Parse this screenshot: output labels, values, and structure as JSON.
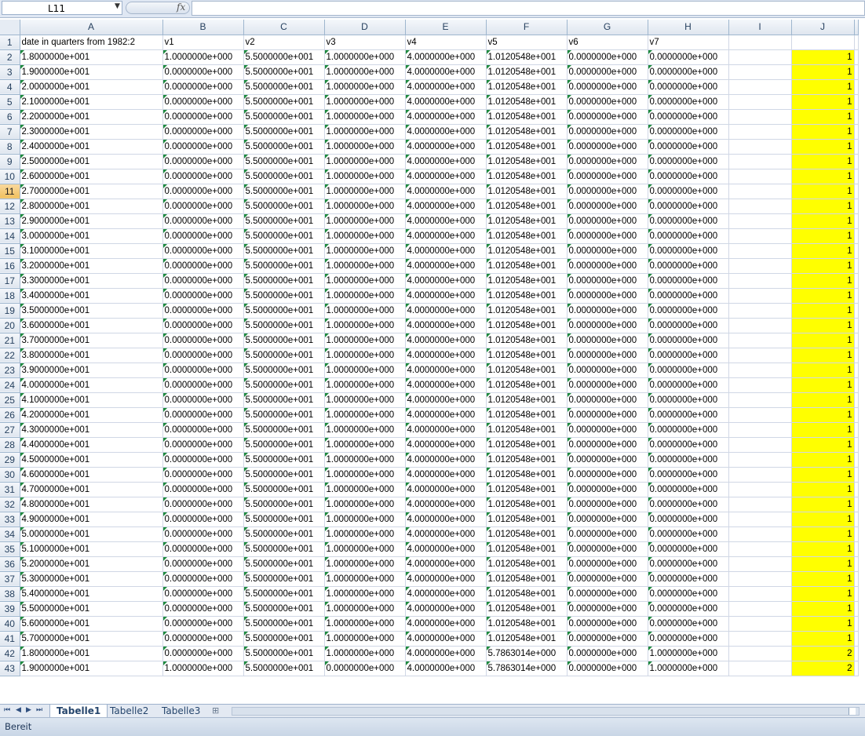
{
  "formula_bar": {
    "name_box": "L11",
    "fx": "fx",
    "formula": ""
  },
  "columns": [
    "A",
    "B",
    "C",
    "D",
    "E",
    "F",
    "G",
    "H",
    "I",
    "J"
  ],
  "selected_row": 11,
  "header_row": {
    "A": "date in quarters from 1982:2",
    "B": "v1",
    "C": "v2",
    "D": "v3",
    "E": "v4",
    "F": "v5",
    "G": "v6",
    "H": "v7"
  },
  "rows": [
    {
      "n": 2,
      "A": "1.8000000e+001",
      "B": "1.0000000e+000",
      "C": "5.5000000e+001",
      "D": "1.0000000e+000",
      "E": "4.0000000e+000",
      "F": "1.0120548e+001",
      "G": "0.0000000e+000",
      "H": "0.0000000e+000",
      "J": "1"
    },
    {
      "n": 3,
      "A": "1.9000000e+001",
      "B": "0.0000000e+000",
      "C": "5.5000000e+001",
      "D": "1.0000000e+000",
      "E": "4.0000000e+000",
      "F": "1.0120548e+001",
      "G": "0.0000000e+000",
      "H": "0.0000000e+000",
      "J": "1"
    },
    {
      "n": 4,
      "A": "2.0000000e+001",
      "B": "0.0000000e+000",
      "C": "5.5000000e+001",
      "D": "1.0000000e+000",
      "E": "4.0000000e+000",
      "F": "1.0120548e+001",
      "G": "0.0000000e+000",
      "H": "0.0000000e+000",
      "J": "1"
    },
    {
      "n": 5,
      "A": "2.1000000e+001",
      "B": "0.0000000e+000",
      "C": "5.5000000e+001",
      "D": "1.0000000e+000",
      "E": "4.0000000e+000",
      "F": "1.0120548e+001",
      "G": "0.0000000e+000",
      "H": "0.0000000e+000",
      "J": "1"
    },
    {
      "n": 6,
      "A": "2.2000000e+001",
      "B": "0.0000000e+000",
      "C": "5.5000000e+001",
      "D": "1.0000000e+000",
      "E": "4.0000000e+000",
      "F": "1.0120548e+001",
      "G": "0.0000000e+000",
      "H": "0.0000000e+000",
      "J": "1"
    },
    {
      "n": 7,
      "A": "2.3000000e+001",
      "B": "0.0000000e+000",
      "C": "5.5000000e+001",
      "D": "1.0000000e+000",
      "E": "4.0000000e+000",
      "F": "1.0120548e+001",
      "G": "0.0000000e+000",
      "H": "0.0000000e+000",
      "J": "1"
    },
    {
      "n": 8,
      "A": "2.4000000e+001",
      "B": "0.0000000e+000",
      "C": "5.5000000e+001",
      "D": "1.0000000e+000",
      "E": "4.0000000e+000",
      "F": "1.0120548e+001",
      "G": "0.0000000e+000",
      "H": "0.0000000e+000",
      "J": "1"
    },
    {
      "n": 9,
      "A": "2.5000000e+001",
      "B": "0.0000000e+000",
      "C": "5.5000000e+001",
      "D": "1.0000000e+000",
      "E": "4.0000000e+000",
      "F": "1.0120548e+001",
      "G": "0.0000000e+000",
      "H": "0.0000000e+000",
      "J": "1"
    },
    {
      "n": 10,
      "A": "2.6000000e+001",
      "B": "0.0000000e+000",
      "C": "5.5000000e+001",
      "D": "1.0000000e+000",
      "E": "4.0000000e+000",
      "F": "1.0120548e+001",
      "G": "0.0000000e+000",
      "H": "0.0000000e+000",
      "J": "1"
    },
    {
      "n": 11,
      "A": "2.7000000e+001",
      "B": "0.0000000e+000",
      "C": "5.5000000e+001",
      "D": "1.0000000e+000",
      "E": "4.0000000e+000",
      "F": "1.0120548e+001",
      "G": "0.0000000e+000",
      "H": "0.0000000e+000",
      "J": "1"
    },
    {
      "n": 12,
      "A": "2.8000000e+001",
      "B": "0.0000000e+000",
      "C": "5.5000000e+001",
      "D": "1.0000000e+000",
      "E": "4.0000000e+000",
      "F": "1.0120548e+001",
      "G": "0.0000000e+000",
      "H": "0.0000000e+000",
      "J": "1"
    },
    {
      "n": 13,
      "A": "2.9000000e+001",
      "B": "0.0000000e+000",
      "C": "5.5000000e+001",
      "D": "1.0000000e+000",
      "E": "4.0000000e+000",
      "F": "1.0120548e+001",
      "G": "0.0000000e+000",
      "H": "0.0000000e+000",
      "J": "1"
    },
    {
      "n": 14,
      "A": "3.0000000e+001",
      "B": "0.0000000e+000",
      "C": "5.5000000e+001",
      "D": "1.0000000e+000",
      "E": "4.0000000e+000",
      "F": "1.0120548e+001",
      "G": "0.0000000e+000",
      "H": "0.0000000e+000",
      "J": "1"
    },
    {
      "n": 15,
      "A": "3.1000000e+001",
      "B": "0.0000000e+000",
      "C": "5.5000000e+001",
      "D": "1.0000000e+000",
      "E": "4.0000000e+000",
      "F": "1.0120548e+001",
      "G": "0.0000000e+000",
      "H": "0.0000000e+000",
      "J": "1"
    },
    {
      "n": 16,
      "A": "3.2000000e+001",
      "B": "0.0000000e+000",
      "C": "5.5000000e+001",
      "D": "1.0000000e+000",
      "E": "4.0000000e+000",
      "F": "1.0120548e+001",
      "G": "0.0000000e+000",
      "H": "0.0000000e+000",
      "J": "1"
    },
    {
      "n": 17,
      "A": "3.3000000e+001",
      "B": "0.0000000e+000",
      "C": "5.5000000e+001",
      "D": "1.0000000e+000",
      "E": "4.0000000e+000",
      "F": "1.0120548e+001",
      "G": "0.0000000e+000",
      "H": "0.0000000e+000",
      "J": "1"
    },
    {
      "n": 18,
      "A": "3.4000000e+001",
      "B": "0.0000000e+000",
      "C": "5.5000000e+001",
      "D": "1.0000000e+000",
      "E": "4.0000000e+000",
      "F": "1.0120548e+001",
      "G": "0.0000000e+000",
      "H": "0.0000000e+000",
      "J": "1"
    },
    {
      "n": 19,
      "A": "3.5000000e+001",
      "B": "0.0000000e+000",
      "C": "5.5000000e+001",
      "D": "1.0000000e+000",
      "E": "4.0000000e+000",
      "F": "1.0120548e+001",
      "G": "0.0000000e+000",
      "H": "0.0000000e+000",
      "J": "1"
    },
    {
      "n": 20,
      "A": "3.6000000e+001",
      "B": "0.0000000e+000",
      "C": "5.5000000e+001",
      "D": "1.0000000e+000",
      "E": "4.0000000e+000",
      "F": "1.0120548e+001",
      "G": "0.0000000e+000",
      "H": "0.0000000e+000",
      "J": "1"
    },
    {
      "n": 21,
      "A": "3.7000000e+001",
      "B": "0.0000000e+000",
      "C": "5.5000000e+001",
      "D": "1.0000000e+000",
      "E": "4.0000000e+000",
      "F": "1.0120548e+001",
      "G": "0.0000000e+000",
      "H": "0.0000000e+000",
      "J": "1"
    },
    {
      "n": 22,
      "A": "3.8000000e+001",
      "B": "0.0000000e+000",
      "C": "5.5000000e+001",
      "D": "1.0000000e+000",
      "E": "4.0000000e+000",
      "F": "1.0120548e+001",
      "G": "0.0000000e+000",
      "H": "0.0000000e+000",
      "J": "1"
    },
    {
      "n": 23,
      "A": "3.9000000e+001",
      "B": "0.0000000e+000",
      "C": "5.5000000e+001",
      "D": "1.0000000e+000",
      "E": "4.0000000e+000",
      "F": "1.0120548e+001",
      "G": "0.0000000e+000",
      "H": "0.0000000e+000",
      "J": "1"
    },
    {
      "n": 24,
      "A": "4.0000000e+001",
      "B": "0.0000000e+000",
      "C": "5.5000000e+001",
      "D": "1.0000000e+000",
      "E": "4.0000000e+000",
      "F": "1.0120548e+001",
      "G": "0.0000000e+000",
      "H": "0.0000000e+000",
      "J": "1"
    },
    {
      "n": 25,
      "A": "4.1000000e+001",
      "B": "0.0000000e+000",
      "C": "5.5000000e+001",
      "D": "1.0000000e+000",
      "E": "4.0000000e+000",
      "F": "1.0120548e+001",
      "G": "0.0000000e+000",
      "H": "0.0000000e+000",
      "J": "1"
    },
    {
      "n": 26,
      "A": "4.2000000e+001",
      "B": "0.0000000e+000",
      "C": "5.5000000e+001",
      "D": "1.0000000e+000",
      "E": "4.0000000e+000",
      "F": "1.0120548e+001",
      "G": "0.0000000e+000",
      "H": "0.0000000e+000",
      "J": "1"
    },
    {
      "n": 27,
      "A": "4.3000000e+001",
      "B": "0.0000000e+000",
      "C": "5.5000000e+001",
      "D": "1.0000000e+000",
      "E": "4.0000000e+000",
      "F": "1.0120548e+001",
      "G": "0.0000000e+000",
      "H": "0.0000000e+000",
      "J": "1"
    },
    {
      "n": 28,
      "A": "4.4000000e+001",
      "B": "0.0000000e+000",
      "C": "5.5000000e+001",
      "D": "1.0000000e+000",
      "E": "4.0000000e+000",
      "F": "1.0120548e+001",
      "G": "0.0000000e+000",
      "H": "0.0000000e+000",
      "J": "1"
    },
    {
      "n": 29,
      "A": "4.5000000e+001",
      "B": "0.0000000e+000",
      "C": "5.5000000e+001",
      "D": "1.0000000e+000",
      "E": "4.0000000e+000",
      "F": "1.0120548e+001",
      "G": "0.0000000e+000",
      "H": "0.0000000e+000",
      "J": "1"
    },
    {
      "n": 30,
      "A": "4.6000000e+001",
      "B": "0.0000000e+000",
      "C": "5.5000000e+001",
      "D": "1.0000000e+000",
      "E": "4.0000000e+000",
      "F": "1.0120548e+001",
      "G": "0.0000000e+000",
      "H": "0.0000000e+000",
      "J": "1"
    },
    {
      "n": 31,
      "A": "4.7000000e+001",
      "B": "0.0000000e+000",
      "C": "5.5000000e+001",
      "D": "1.0000000e+000",
      "E": "4.0000000e+000",
      "F": "1.0120548e+001",
      "G": "0.0000000e+000",
      "H": "0.0000000e+000",
      "J": "1"
    },
    {
      "n": 32,
      "A": "4.8000000e+001",
      "B": "0.0000000e+000",
      "C": "5.5000000e+001",
      "D": "1.0000000e+000",
      "E": "4.0000000e+000",
      "F": "1.0120548e+001",
      "G": "0.0000000e+000",
      "H": "0.0000000e+000",
      "J": "1"
    },
    {
      "n": 33,
      "A": "4.9000000e+001",
      "B": "0.0000000e+000",
      "C": "5.5000000e+001",
      "D": "1.0000000e+000",
      "E": "4.0000000e+000",
      "F": "1.0120548e+001",
      "G": "0.0000000e+000",
      "H": "0.0000000e+000",
      "J": "1"
    },
    {
      "n": 34,
      "A": "5.0000000e+001",
      "B": "0.0000000e+000",
      "C": "5.5000000e+001",
      "D": "1.0000000e+000",
      "E": "4.0000000e+000",
      "F": "1.0120548e+001",
      "G": "0.0000000e+000",
      "H": "0.0000000e+000",
      "J": "1"
    },
    {
      "n": 35,
      "A": "5.1000000e+001",
      "B": "0.0000000e+000",
      "C": "5.5000000e+001",
      "D": "1.0000000e+000",
      "E": "4.0000000e+000",
      "F": "1.0120548e+001",
      "G": "0.0000000e+000",
      "H": "0.0000000e+000",
      "J": "1"
    },
    {
      "n": 36,
      "A": "5.2000000e+001",
      "B": "0.0000000e+000",
      "C": "5.5000000e+001",
      "D": "1.0000000e+000",
      "E": "4.0000000e+000",
      "F": "1.0120548e+001",
      "G": "0.0000000e+000",
      "H": "0.0000000e+000",
      "J": "1"
    },
    {
      "n": 37,
      "A": "5.3000000e+001",
      "B": "0.0000000e+000",
      "C": "5.5000000e+001",
      "D": "1.0000000e+000",
      "E": "4.0000000e+000",
      "F": "1.0120548e+001",
      "G": "0.0000000e+000",
      "H": "0.0000000e+000",
      "J": "1"
    },
    {
      "n": 38,
      "A": "5.4000000e+001",
      "B": "0.0000000e+000",
      "C": "5.5000000e+001",
      "D": "1.0000000e+000",
      "E": "4.0000000e+000",
      "F": "1.0120548e+001",
      "G": "0.0000000e+000",
      "H": "0.0000000e+000",
      "J": "1"
    },
    {
      "n": 39,
      "A": "5.5000000e+001",
      "B": "0.0000000e+000",
      "C": "5.5000000e+001",
      "D": "1.0000000e+000",
      "E": "4.0000000e+000",
      "F": "1.0120548e+001",
      "G": "0.0000000e+000",
      "H": "0.0000000e+000",
      "J": "1"
    },
    {
      "n": 40,
      "A": "5.6000000e+001",
      "B": "0.0000000e+000",
      "C": "5.5000000e+001",
      "D": "1.0000000e+000",
      "E": "4.0000000e+000",
      "F": "1.0120548e+001",
      "G": "0.0000000e+000",
      "H": "0.0000000e+000",
      "J": "1"
    },
    {
      "n": 41,
      "A": "5.7000000e+001",
      "B": "0.0000000e+000",
      "C": "5.5000000e+001",
      "D": "1.0000000e+000",
      "E": "4.0000000e+000",
      "F": "1.0120548e+001",
      "G": "0.0000000e+000",
      "H": "0.0000000e+000",
      "J": "1"
    },
    {
      "n": 42,
      "A": "1.8000000e+001",
      "B": "0.0000000e+000",
      "C": "5.5000000e+001",
      "D": "1.0000000e+000",
      "E": "4.0000000e+000",
      "F": "5.7863014e+000",
      "G": "0.0000000e+000",
      "H": "1.0000000e+000",
      "J": "2"
    },
    {
      "n": 43,
      "A": "1.9000000e+001",
      "B": "1.0000000e+000",
      "C": "5.5000000e+001",
      "D": "0.0000000e+000",
      "E": "4.0000000e+000",
      "F": "5.7863014e+000",
      "G": "0.0000000e+000",
      "H": "1.0000000e+000",
      "J": "2"
    }
  ],
  "sheet_tabs": [
    "Tabelle1",
    "Tabelle2",
    "Tabelle3"
  ],
  "active_tab": "Tabelle1",
  "status": {
    "text": "Bereit"
  },
  "colors": {
    "highlight": "#ffff00",
    "indicator": "#1e8a3e",
    "selected_header": "#f1c15f"
  }
}
